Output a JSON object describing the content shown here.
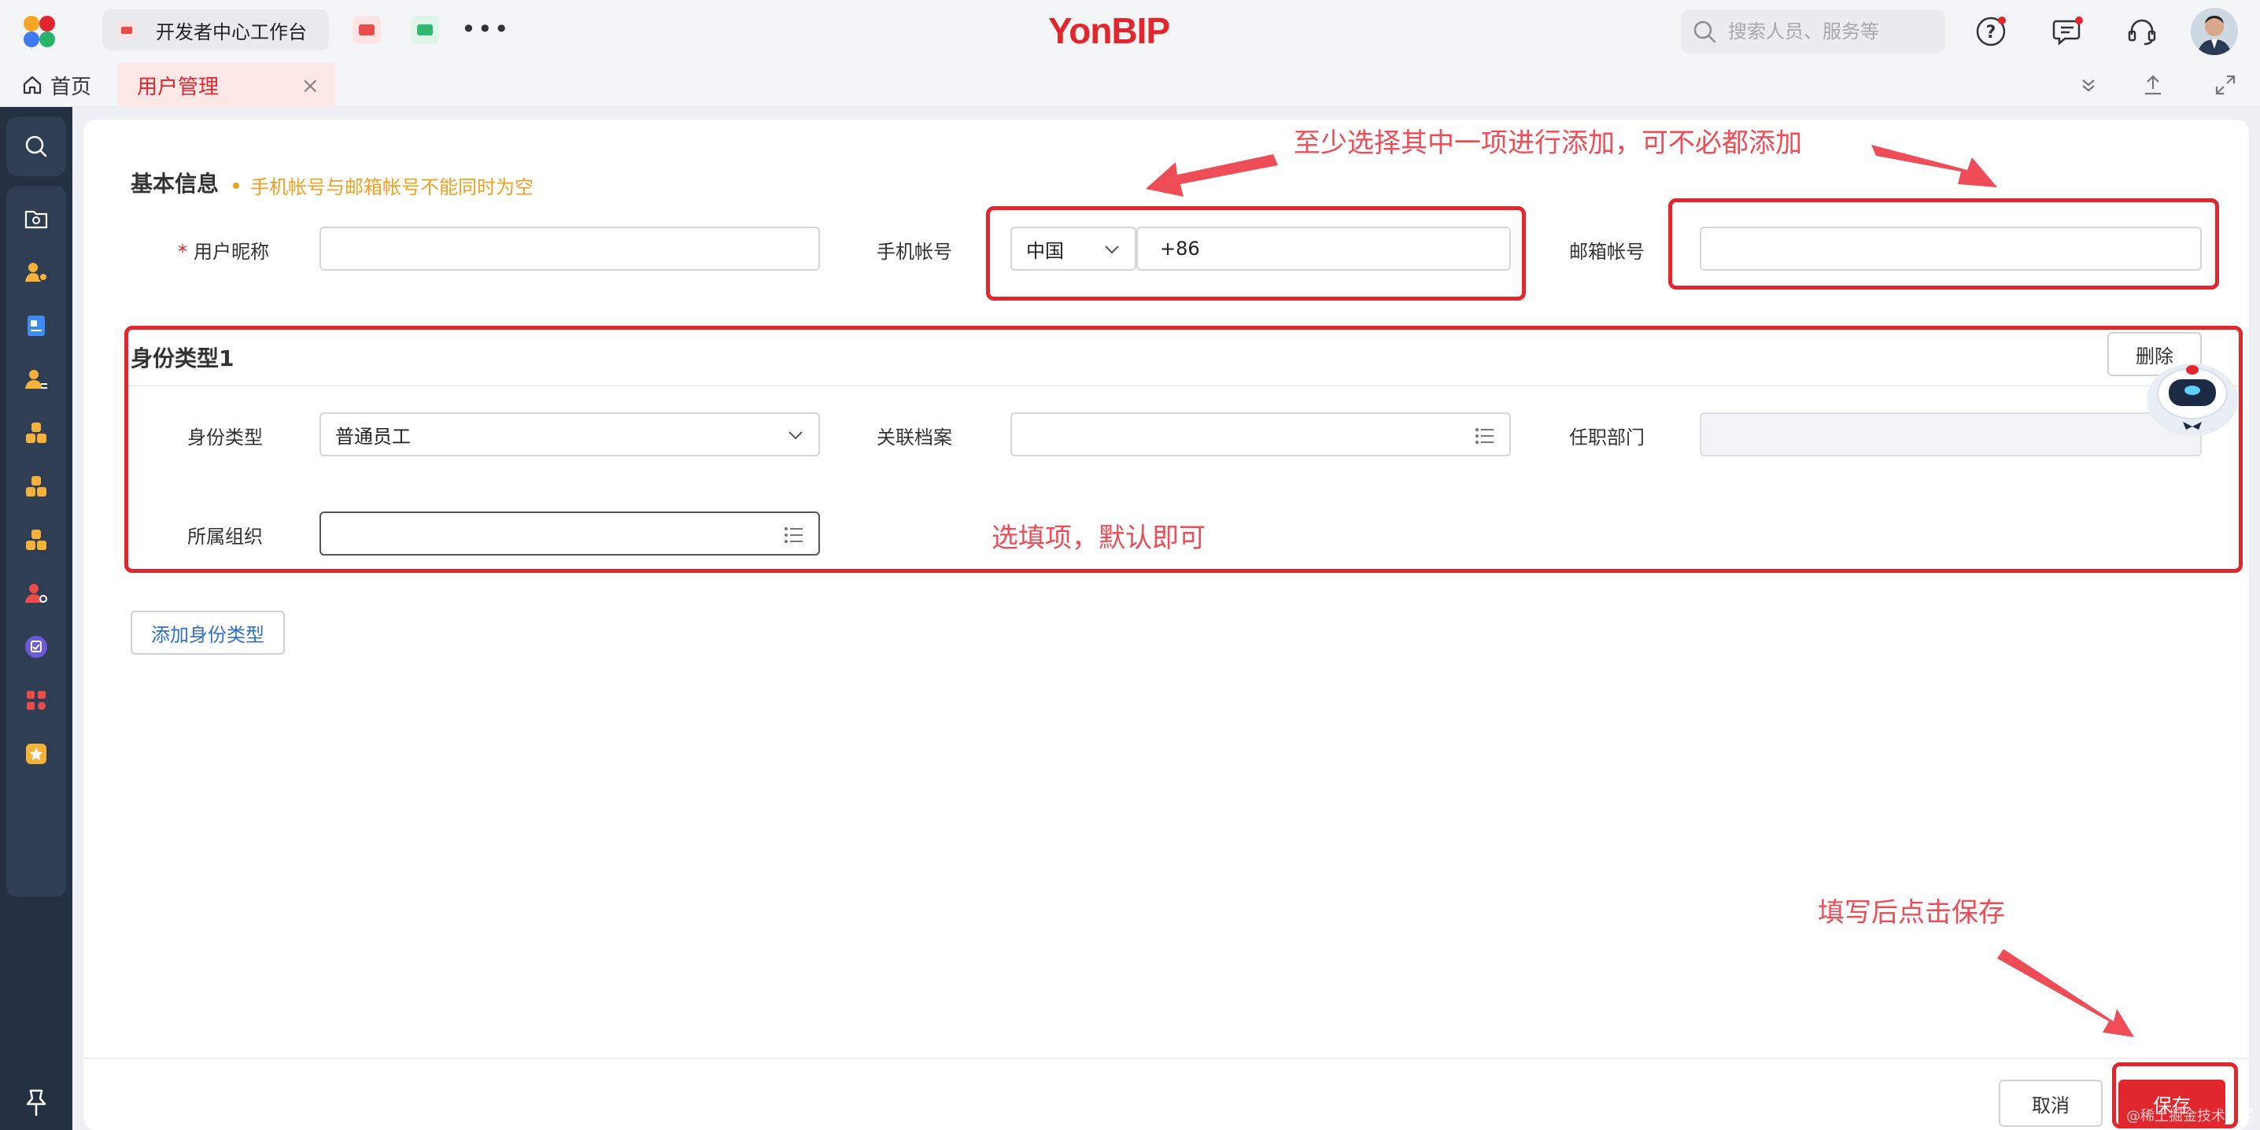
{
  "header": {
    "workbench_tab": "开发者中心工作台",
    "more": "•••",
    "brand": "YonBIP",
    "search_placeholder": "搜索人员、服务等"
  },
  "tabs": {
    "home": "首页",
    "active": "用户管理",
    "close": "×"
  },
  "form": {
    "basic_title": "基本信息",
    "basic_note": "手机帐号与邮箱帐号不能同时为空",
    "required_mark": "*",
    "nickname_label": "用户昵称",
    "nickname_value": "",
    "phone_label": "手机帐号",
    "country_value": "中国",
    "phone_value": "+86",
    "email_label": "邮箱帐号",
    "email_value": "",
    "identity_title": "身份类型1",
    "delete_label": "删除",
    "identity_type_label": "身份类型",
    "identity_type_value": "普通员工",
    "linked_profile_label": "关联档案",
    "linked_profile_value": "",
    "department_label": "任职部门",
    "department_value": "",
    "org_label": "所属组织",
    "org_value": "",
    "add_identity_label": "添加身份类型"
  },
  "footer": {
    "cancel_label": "取消",
    "save_label": "保存",
    "watermark": "@稀土掘金技术社区"
  },
  "annotations": {
    "top_note": "至少选择其中一项进行添加，可不必都添加",
    "optional_note": "选填项，默认即可",
    "save_note": "填写后点击保存"
  },
  "colors": {
    "brand_red": "#e1262d",
    "annotation_red": "#ee4c56",
    "sidebar_bg": "#233143",
    "note_orange": "#f0a020"
  }
}
